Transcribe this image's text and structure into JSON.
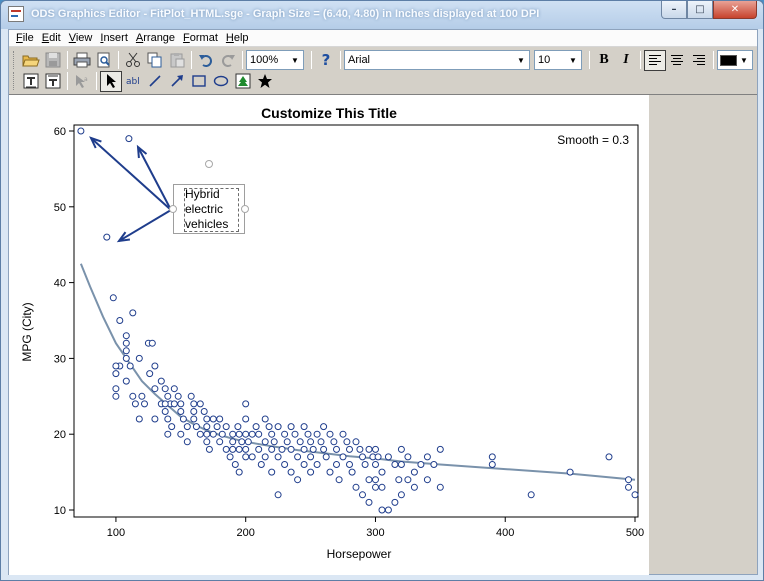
{
  "window": {
    "title": "ODS Graphics Editor - FitPlot_HTML.sge - Graph Size = (6.40, 4.80) in Inches displayed at 100 DPI",
    "minimize": "–",
    "maximize": "□",
    "close": "✕"
  },
  "menu": [
    "File",
    "Edit",
    "View",
    "Insert",
    "Arrange",
    "Format",
    "Help"
  ],
  "toolbar": {
    "zoom": "100%",
    "help": "?",
    "font_family": "Arial",
    "font_size": "10",
    "bold": "B",
    "italic": "I",
    "text_color": "#000000"
  },
  "icons": {
    "open": "folder-open-icon",
    "save": "save-icon",
    "print": "print-icon",
    "print_preview": "print-preview-icon",
    "cut": "cut-icon",
    "copy": "copy-icon",
    "paste": "paste-icon",
    "undo": "undo-icon",
    "redo": "redo-icon",
    "align_left": "align-left-icon",
    "align_center": "align-center-icon",
    "align_right": "align-right-icon"
  },
  "chart_data": {
    "type": "scatter",
    "title": "Customize This Title",
    "xlabel": "Horsepower",
    "ylabel": "MPG (City)",
    "annotation": "Smooth = 0.3",
    "xlim": [
      70,
      500
    ],
    "ylim": [
      10,
      60
    ],
    "xticks": [
      100,
      200,
      300,
      400,
      500
    ],
    "yticks": [
      10,
      20,
      30,
      40,
      50,
      60
    ],
    "marker_color": "#1f3d8c",
    "fit_color": "#7a92ab",
    "points": [
      [
        73,
        60
      ],
      [
        110,
        59
      ],
      [
        93,
        46
      ],
      [
        98,
        38
      ],
      [
        103,
        35
      ],
      [
        113,
        36
      ],
      [
        108,
        33
      ],
      [
        108,
        32
      ],
      [
        108,
        31
      ],
      [
        108,
        30
      ],
      [
        103,
        29
      ],
      [
        100,
        29
      ],
      [
        100,
        28
      ],
      [
        111,
        29
      ],
      [
        118,
        30
      ],
      [
        125,
        32
      ],
      [
        128,
        32
      ],
      [
        130,
        29
      ],
      [
        126,
        28
      ],
      [
        100,
        26
      ],
      [
        100,
        25
      ],
      [
        108,
        27
      ],
      [
        113,
        25
      ],
      [
        115,
        24
      ],
      [
        120,
        25
      ],
      [
        122,
        24
      ],
      [
        118,
        22
      ],
      [
        130,
        26
      ],
      [
        135,
        27
      ],
      [
        138,
        26
      ],
      [
        140,
        25
      ],
      [
        142,
        24
      ],
      [
        138,
        23
      ],
      [
        140,
        22
      ],
      [
        145,
        26
      ],
      [
        148,
        25
      ],
      [
        150,
        24
      ],
      [
        150,
        23
      ],
      [
        152,
        22
      ],
      [
        155,
        21
      ],
      [
        130,
        22
      ],
      [
        135,
        24
      ],
      [
        138,
        24
      ],
      [
        140,
        20
      ],
      [
        143,
        21
      ],
      [
        145,
        24
      ],
      [
        150,
        20
      ],
      [
        155,
        19
      ],
      [
        158,
        25
      ],
      [
        160,
        24
      ],
      [
        160,
        23
      ],
      [
        160,
        22
      ],
      [
        162,
        21
      ],
      [
        165,
        20
      ],
      [
        165,
        24
      ],
      [
        168,
        23
      ],
      [
        170,
        22
      ],
      [
        170,
        21
      ],
      [
        170,
        20
      ],
      [
        170,
        19
      ],
      [
        172,
        18
      ],
      [
        175,
        22
      ],
      [
        175,
        20
      ],
      [
        178,
        21
      ],
      [
        180,
        22
      ],
      [
        180,
        19
      ],
      [
        182,
        20
      ],
      [
        185,
        21
      ],
      [
        185,
        18
      ],
      [
        188,
        17
      ],
      [
        190,
        20
      ],
      [
        190,
        19
      ],
      [
        190,
        18
      ],
      [
        192,
        16
      ],
      [
        194,
        21
      ],
      [
        195,
        20
      ],
      [
        195,
        18
      ],
      [
        195,
        15
      ],
      [
        197,
        19
      ],
      [
        200,
        22
      ],
      [
        200,
        20
      ],
      [
        200,
        18
      ],
      [
        200,
        17
      ],
      [
        200,
        24
      ],
      [
        202,
        19
      ],
      [
        205,
        20
      ],
      [
        205,
        17
      ],
      [
        208,
        21
      ],
      [
        210,
        20
      ],
      [
        210,
        18
      ],
      [
        212,
        16
      ],
      [
        215,
        22
      ],
      [
        215,
        19
      ],
      [
        215,
        17
      ],
      [
        218,
        21
      ],
      [
        220,
        20
      ],
      [
        220,
        18
      ],
      [
        220,
        15
      ],
      [
        222,
        19
      ],
      [
        225,
        21
      ],
      [
        225,
        17
      ],
      [
        225,
        12
      ],
      [
        228,
        18
      ],
      [
        230,
        20
      ],
      [
        230,
        16
      ],
      [
        232,
        19
      ],
      [
        235,
        21
      ],
      [
        235,
        18
      ],
      [
        235,
        15
      ],
      [
        238,
        20
      ],
      [
        240,
        17
      ],
      [
        240,
        14
      ],
      [
        242,
        19
      ],
      [
        245,
        21
      ],
      [
        245,
        18
      ],
      [
        245,
        16
      ],
      [
        248,
        20
      ],
      [
        250,
        19
      ],
      [
        250,
        17
      ],
      [
        250,
        15
      ],
      [
        252,
        18
      ],
      [
        255,
        20
      ],
      [
        255,
        16
      ],
      [
        258,
        19
      ],
      [
        260,
        21
      ],
      [
        260,
        18
      ],
      [
        262,
        17
      ],
      [
        265,
        20
      ],
      [
        265,
        15
      ],
      [
        268,
        19
      ],
      [
        270,
        18
      ],
      [
        270,
        16
      ],
      [
        272,
        14
      ],
      [
        275,
        20
      ],
      [
        275,
        17
      ],
      [
        278,
        19
      ],
      [
        280,
        18
      ],
      [
        280,
        16
      ],
      [
        282,
        15
      ],
      [
        285,
        19
      ],
      [
        285,
        13
      ],
      [
        288,
        18
      ],
      [
        290,
        17
      ],
      [
        290,
        12
      ],
      [
        292,
        16
      ],
      [
        295,
        18
      ],
      [
        295,
        14
      ],
      [
        298,
        17
      ],
      [
        300,
        18
      ],
      [
        300,
        16
      ],
      [
        300,
        14
      ],
      [
        300,
        13
      ],
      [
        302,
        17
      ],
      [
        305,
        15
      ],
      [
        305,
        13
      ],
      [
        310,
        10
      ],
      [
        310,
        17
      ],
      [
        315,
        16
      ],
      [
        318,
        14
      ],
      [
        320,
        18
      ],
      [
        320,
        16
      ],
      [
        320,
        12
      ],
      [
        325,
        17
      ],
      [
        325,
        14
      ],
      [
        330,
        15
      ],
      [
        330,
        13
      ],
      [
        335,
        16
      ],
      [
        340,
        17
      ],
      [
        340,
        14
      ],
      [
        345,
        16
      ],
      [
        350,
        18
      ],
      [
        350,
        13
      ],
      [
        305,
        10
      ],
      [
        295,
        11
      ],
      [
        315,
        11
      ],
      [
        390,
        17
      ],
      [
        390,
        16
      ],
      [
        420,
        12
      ],
      [
        450,
        15
      ],
      [
        480,
        17
      ],
      [
        495,
        14
      ],
      [
        495,
        13
      ],
      [
        500,
        12
      ]
    ],
    "fit_line": [
      [
        73,
        42.5
      ],
      [
        80,
        39.5
      ],
      [
        90,
        35.5
      ],
      [
        100,
        32
      ],
      [
        110,
        29.5
      ],
      [
        120,
        27
      ],
      [
        130,
        25.3
      ],
      [
        140,
        23.8
      ],
      [
        150,
        22.3
      ],
      [
        160,
        21.3
      ],
      [
        170,
        20.5
      ],
      [
        180,
        19.9
      ],
      [
        190,
        19.4
      ],
      [
        200,
        19
      ],
      [
        220,
        18.4
      ],
      [
        240,
        17.9
      ],
      [
        260,
        17.5
      ],
      [
        280,
        17.1
      ],
      [
        300,
        16.8
      ],
      [
        320,
        16.4
      ],
      [
        350,
        16
      ],
      [
        400,
        15.4
      ],
      [
        450,
        14.8
      ],
      [
        500,
        14
      ]
    ]
  },
  "text_box": {
    "lines": [
      "Hybrid",
      "electric",
      "vehicles"
    ]
  },
  "arrow_color": "#1f3d8c"
}
